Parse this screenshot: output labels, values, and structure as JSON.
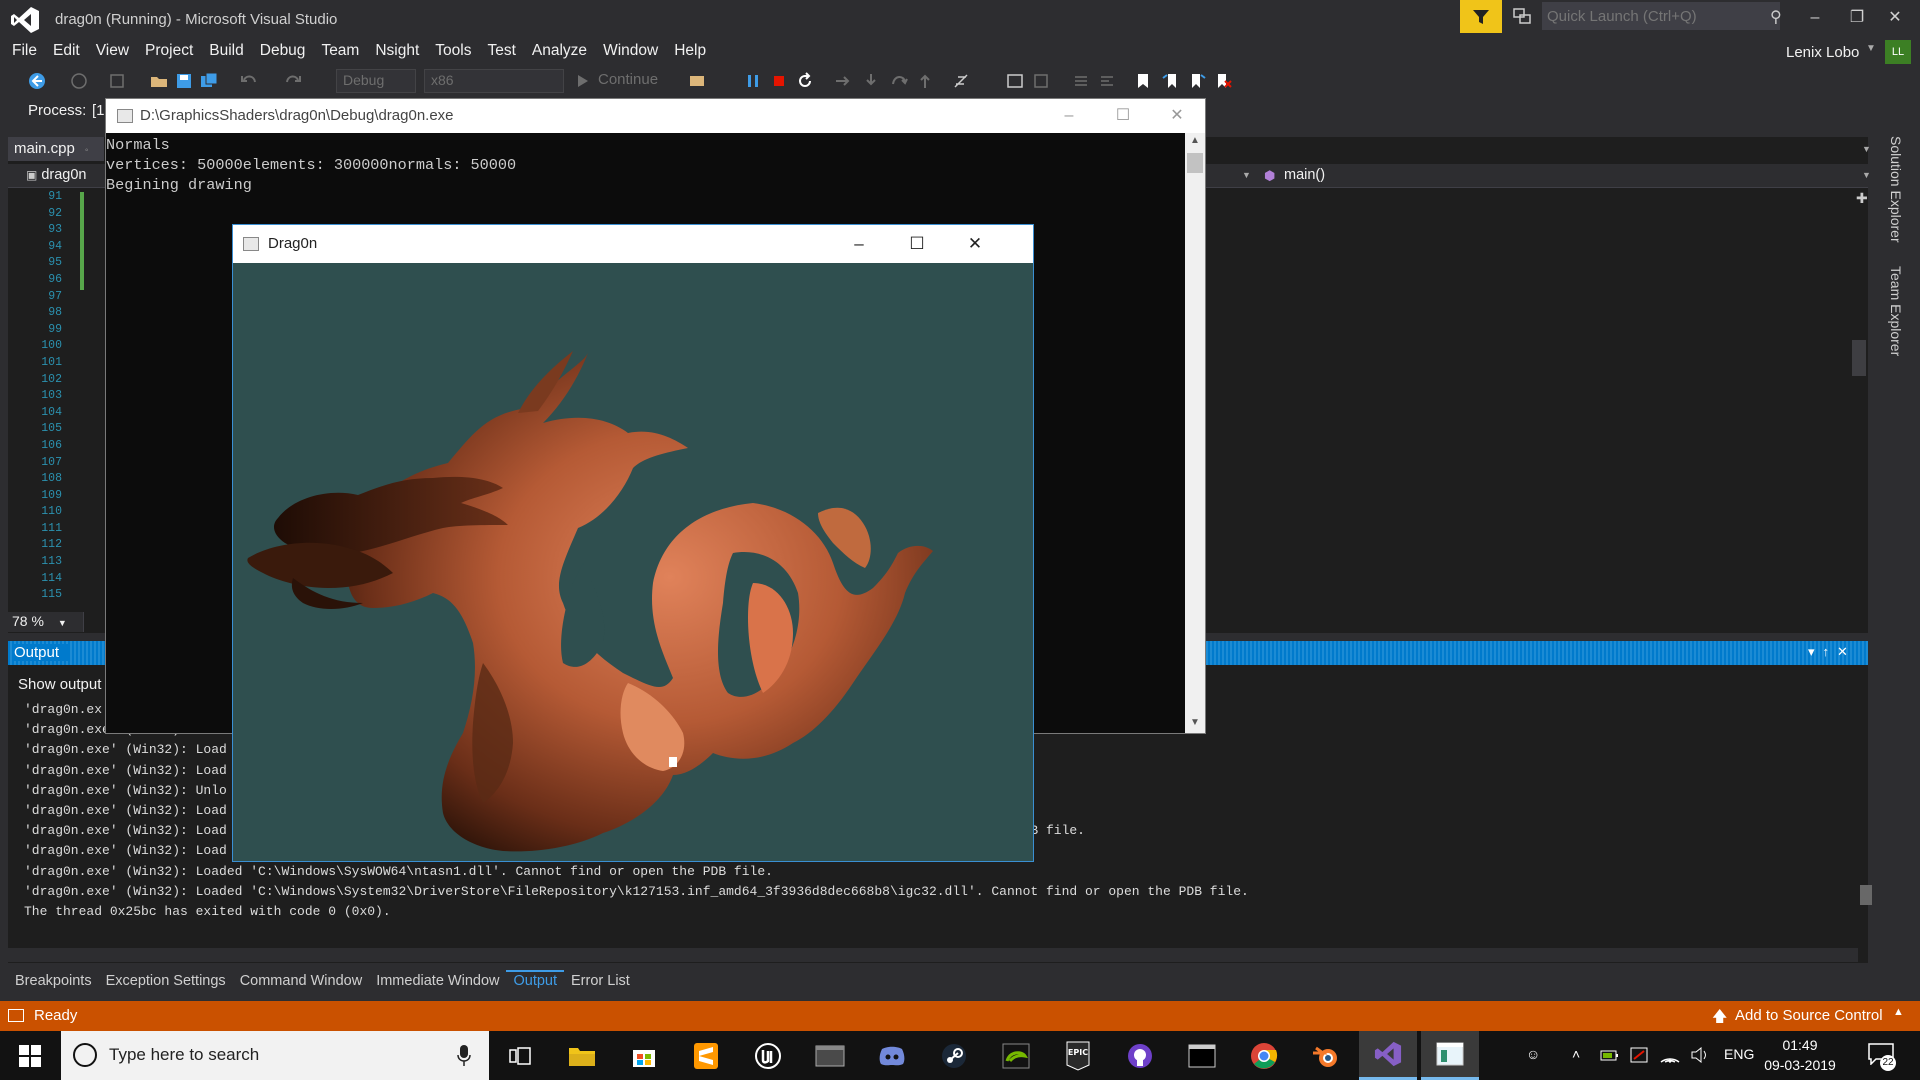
{
  "window": {
    "title": "drag0n (Running) - Microsoft Visual Studio"
  },
  "quick_launch": {
    "placeholder": "Quick Launch (Ctrl+Q)"
  },
  "menu": [
    "File",
    "Edit",
    "View",
    "Project",
    "Build",
    "Debug",
    "Team",
    "Nsight",
    "Tools",
    "Test",
    "Analyze",
    "Window",
    "Help"
  ],
  "user": {
    "name": "Lenix Lobo",
    "initials": "LL"
  },
  "toolbar": {
    "config": "Debug",
    "platform": "x86",
    "continue_label": "Continue"
  },
  "process": {
    "label": "Process:",
    "value": "[1"
  },
  "editor": {
    "tab": "main.cpp",
    "project": "drag0n",
    "function": "main()",
    "line_numbers": [
      "91",
      "92",
      "93",
      "94",
      "95",
      "96",
      "97",
      "98",
      "99",
      "100",
      "101",
      "102",
      "103",
      "104",
      "105",
      "106",
      "107",
      "108",
      "109",
      "110",
      "111",
      "112",
      "113",
      "114",
      "115"
    ],
    "zoom": "78 %"
  },
  "side_tabs": [
    "Solution Explorer",
    "Team Explorer"
  ],
  "output": {
    "title": "Output",
    "show_from": "Show output",
    "lines": [
      "'drag0n.ex",
      "'drag0n.exe' (Win32): Unlo",
      "'drag0n.exe' (Win32): Load",
      "'drag0n.exe' (Win32): Load",
      "'drag0n.exe' (Win32): Unlo",
      "'drag0n.exe' (Win32): Load",
      "'drag0n.exe' (Win32): Load                                                                         l'. Cannot find or open the PDB file.",
      "'drag0n.exe' (Win32): Load",
      "'drag0n.exe' (Win32): Loaded 'C:\\Windows\\SysWOW64\\ntasn1.dll'. Cannot find or open the PDB file.",
      "'drag0n.exe' (Win32): Loaded 'C:\\Windows\\System32\\DriverStore\\FileRepository\\k127153.inf_amd64_3f3936d8dec668b8\\igc32.dll'. Cannot find or open the PDB file.",
      "The thread 0x25bc has exited with code 0 (0x0)."
    ]
  },
  "bottom_tabs": [
    {
      "label": "Breakpoints",
      "active": false
    },
    {
      "label": "Exception Settings",
      "active": false
    },
    {
      "label": "Command Window",
      "active": false
    },
    {
      "label": "Immediate Window",
      "active": false
    },
    {
      "label": "Output",
      "active": true
    },
    {
      "label": "Error List",
      "active": false
    }
  ],
  "status": {
    "text": "Ready",
    "source_control": "Add to Source Control"
  },
  "console": {
    "title": "D:\\GraphicsShaders\\drag0n\\Debug\\drag0n.exe",
    "lines": [
      "Normals",
      "vertices: 50000elements: 300000normals: 50000",
      "Begining drawing"
    ]
  },
  "gl_window": {
    "title": "Drag0n",
    "background_color": "#2f4f4f",
    "model_color": "#c8643c"
  },
  "taskbar": {
    "search_placeholder": "Type here to search",
    "apps": [
      "task-view",
      "file-explorer",
      "store",
      "sublime-text",
      "unreal-engine",
      "terminal-app",
      "discord",
      "steam",
      "nvidia",
      "epic-games",
      "github-desktop",
      "cmd",
      "chrome",
      "blender",
      "visual-studio",
      "drag0n-app"
    ],
    "epic_label": "EPIC",
    "language": "ENG",
    "time": "01:49",
    "date": "09-03-2019",
    "notifications": "22"
  },
  "colors": {
    "accent": "#007acc",
    "status": "#ca5100",
    "filter": "#f0c419"
  }
}
